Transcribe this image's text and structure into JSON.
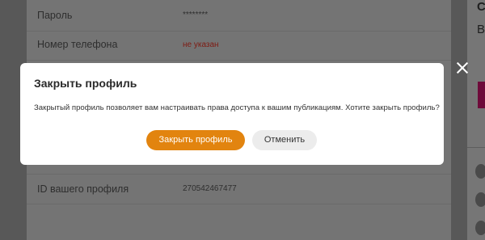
{
  "background": {
    "rows": [
      {
        "label": "Пароль",
        "value": "********",
        "value_style": "normal"
      },
      {
        "label": "Номер телефона",
        "value": "не указан",
        "value_style": "red"
      },
      {
        "label": "ID вашего профиля",
        "value": "270542467477",
        "value_style": "normal"
      }
    ]
  },
  "right_strip": {
    "letter_top": "С",
    "letter_mid": "В"
  },
  "modal": {
    "title": "Закрыть профиль",
    "text": "Закрытый профиль позволяет вам настраивать права доступа к вашим публикациям. Хотите закрыть профиль?",
    "confirm_label": "Закрыть профиль",
    "cancel_label": "Отменить"
  },
  "colors": {
    "primary_button": "#e2840f",
    "secondary_button": "#ececec",
    "not_set_value": "#7e1a12",
    "overlay": "#585858"
  },
  "icons": {
    "close": "close-icon"
  }
}
